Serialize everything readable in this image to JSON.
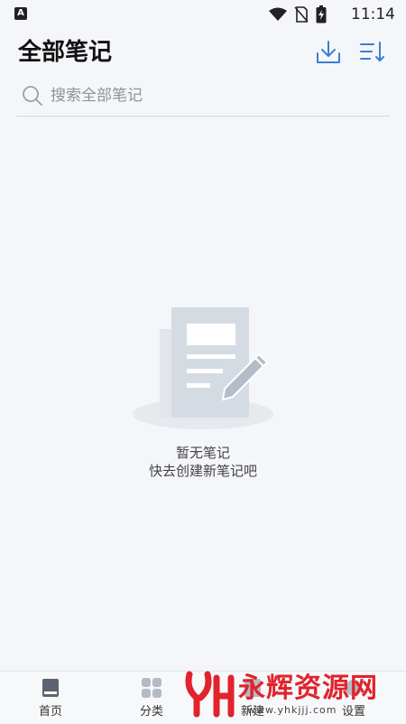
{
  "status_bar": {
    "time": "11:14",
    "icons": [
      "app-a-icon",
      "wifi-icon",
      "no-sim-icon",
      "battery-charging-icon"
    ]
  },
  "header": {
    "title": "全部笔记",
    "actions": [
      "download-icon",
      "sort-icon"
    ]
  },
  "search": {
    "placeholder": "搜索全部笔记"
  },
  "empty_state": {
    "title": "暂无笔记",
    "subtitle": "快去创建新笔记吧"
  },
  "bottom_nav": {
    "items": [
      {
        "label": "首页",
        "icon": "book-icon"
      },
      {
        "label": "分类",
        "icon": "grid-icon"
      },
      {
        "label": "新建",
        "icon": "add-note-icon"
      },
      {
        "label": "设置",
        "icon": "settings-icon"
      }
    ]
  },
  "watermark": {
    "text": "永辉资源网",
    "url": "www.yhkjjj.com"
  },
  "colors": {
    "background": "#f4f6f9",
    "accent": "#3a7fd5",
    "watermark_red": "#e0232c"
  }
}
